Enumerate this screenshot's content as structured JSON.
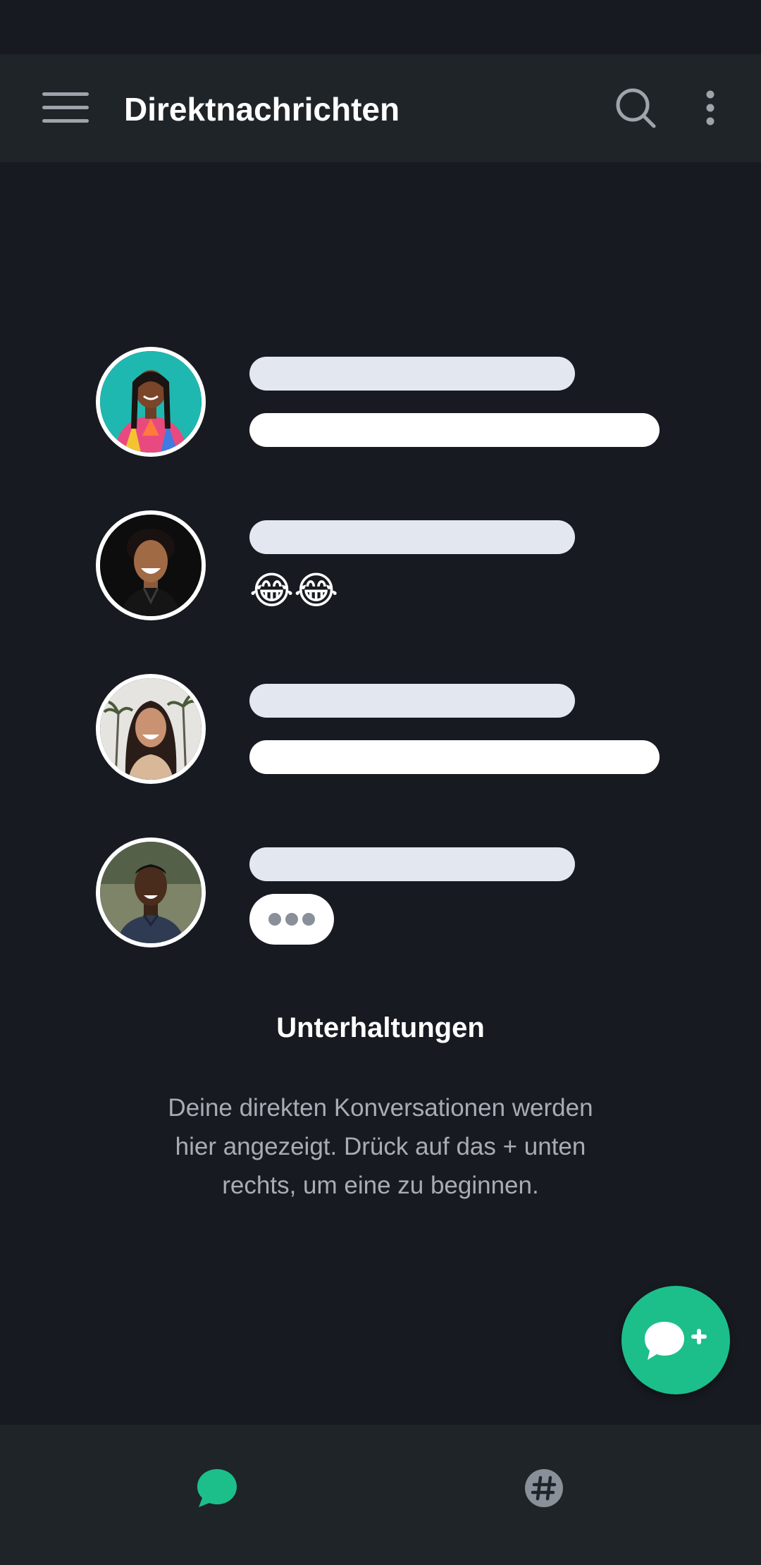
{
  "app_bar": {
    "title": "Direktnachrichten",
    "menu_icon": "hamburger-menu-icon",
    "search_icon": "search-icon",
    "more_icon": "more-vertical-icon"
  },
  "illustration": {
    "rows": [
      {
        "avatar": "woman-colorful-dress-avatar",
        "preview": "bar"
      },
      {
        "avatar": "man-smiling-avatar",
        "preview": "emoji",
        "emoji": "😂😂"
      },
      {
        "avatar": "woman-laughing-palms-avatar",
        "preview": "bar"
      },
      {
        "avatar": "man-portrait-avatar",
        "preview": "typing"
      }
    ]
  },
  "empty_state": {
    "title": "Unterhaltungen",
    "description": "Deine direkten Konversationen werden hier angezeigt. Drück auf das + unten rechts, um eine zu beginnen."
  },
  "fab": {
    "icon": "new-chat-plus-icon"
  },
  "bottom_nav": {
    "items": [
      {
        "icon": "chat-bubble-icon",
        "active": true
      },
      {
        "icon": "hashtag-icon",
        "active": false
      }
    ]
  },
  "colors": {
    "background": "#171a21",
    "bar": "#1f2428",
    "accent": "#1cbf8a",
    "text_primary": "#ffffff",
    "text_secondary": "#a8adb4",
    "icon_gray": "#8a9099"
  }
}
